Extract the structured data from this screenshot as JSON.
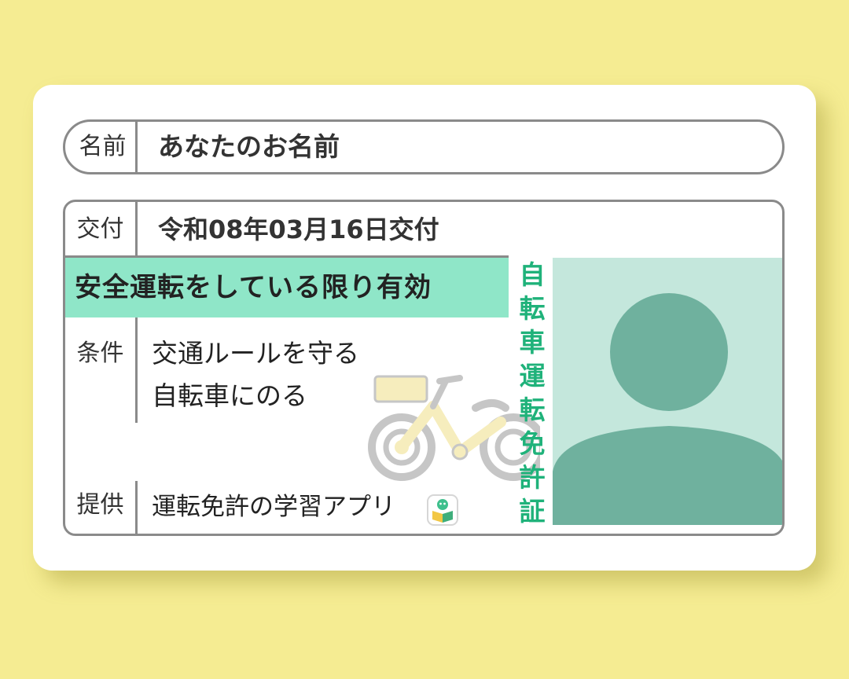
{
  "card": {
    "name_label": "名前",
    "name_value": "あなたのお名前",
    "issue_label": "交付",
    "issue_value": "令和08年03月16日交付",
    "validity_text": "安全運転をしている限り有効",
    "conditions_label": "条件",
    "conditions": [
      "交通ルールを守る",
      "自転車にのる"
    ],
    "provider_label": "提供",
    "provider_value": "運転免許の学習アプリ",
    "vertical_title": [
      "自",
      "転",
      "車",
      "運",
      "転",
      "免",
      "許",
      "証"
    ]
  },
  "colors": {
    "background": "#f5ec92",
    "card": "#ffffff",
    "validity_band": "#8fe6c8",
    "vertical_title": "#1fb27a",
    "photo_bg": "#c4e7dc",
    "avatar": "#6fb19e",
    "border": "#8a8a8a"
  },
  "icons": {
    "bicycle": "bicycle-illustration",
    "avatar": "person-silhouette",
    "app": "app-logo-icon"
  }
}
